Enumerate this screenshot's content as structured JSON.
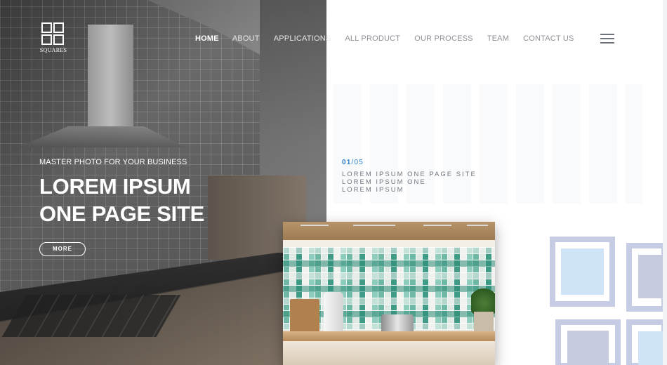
{
  "brand": {
    "name": "SQUARES"
  },
  "nav": {
    "items": [
      {
        "label": "HOME"
      },
      {
        "label": "ABOUT"
      },
      {
        "label": "APPLICATIONS"
      },
      {
        "label": "ALL PRODUCT"
      },
      {
        "label": "OUR PROCESS"
      },
      {
        "label": "TEAM"
      },
      {
        "label": "CONTACT US"
      }
    ],
    "active": "HOME"
  },
  "hero": {
    "kicker": "MASTER PHOTO FOR YOUR BUSINESS",
    "headline_line1": "LOREM IPSUM",
    "headline_line2": "ONE PAGE SITE",
    "button_label": "MORE"
  },
  "slider": {
    "current": "01",
    "separator": "/",
    "total": "05",
    "lines": [
      "LOREM IPSUM ONE PAGE SITE",
      "LOREM IPSUM ONE",
      "LOREM IPSUM"
    ]
  },
  "colors": {
    "accent": "#2f7fcb",
    "nav_dark": "#8c8f96",
    "square_outline": "#c5cce3",
    "square_blue": "#cfe4f7",
    "square_gray": "#c6cbe0"
  },
  "icons": {
    "logo": "squares-logo-icon",
    "menu": "hamburger-menu-icon"
  }
}
